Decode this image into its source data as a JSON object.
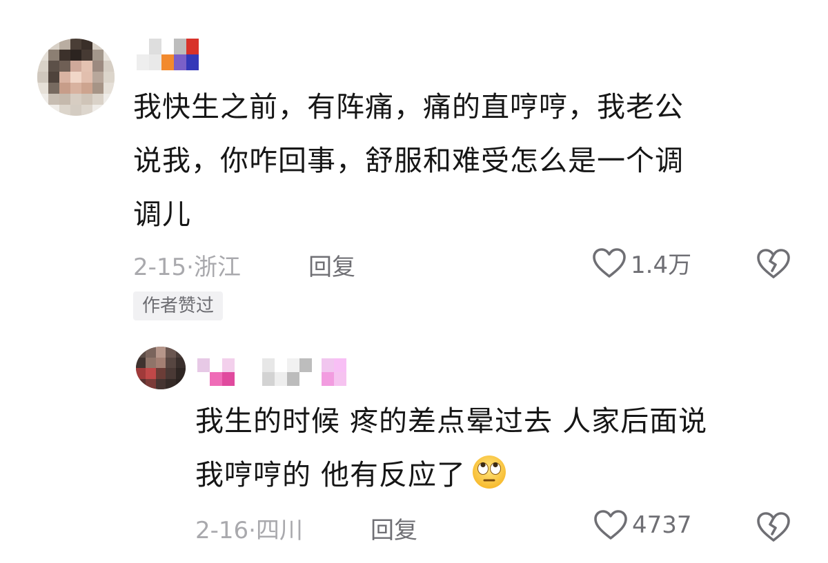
{
  "comment": {
    "text_lines": [
      "我快生之前，有阵痛，痛的直哼哼，我老公",
      "说我，你咋回事，舒服和难受怎么是一个调",
      "调儿"
    ],
    "date": "2-15",
    "location": "浙江",
    "reply_label": "回复",
    "like_count": "1.4万",
    "author_badge": "作者赞过"
  },
  "reply": {
    "text_lines": [
      "我生的时候 疼的差点晕过去 人家后面说",
      "我哼哼的 他有反应了"
    ],
    "emoji_icon": "face-with-rolling-eyes-icon",
    "date": "2-16",
    "location": "四川",
    "reply_label": "回复",
    "like_count": "4737"
  },
  "colors": {
    "text_primary": "#161616",
    "meta_gray": "#a9a9ad",
    "action_gray": "#6f6f74",
    "badge_bg": "#f1f1f3"
  }
}
